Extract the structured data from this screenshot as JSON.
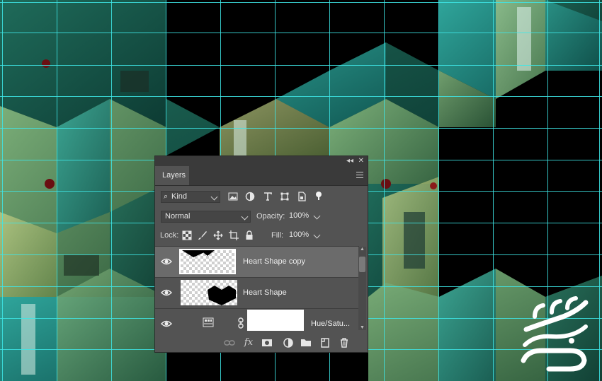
{
  "canvas": {
    "grid_color": "#3ee6e6",
    "background": "#000000"
  },
  "layers_panel": {
    "tab_label": "Layers",
    "collapse_glyph": "◂◂",
    "close_glyph": "✕",
    "filter": {
      "search_glyph": "⌕",
      "kind_label": "Kind",
      "type_icons": [
        "image-filter-icon",
        "adjustment-filter-icon",
        "type-filter-icon",
        "shape-filter-icon",
        "smart-object-filter-icon",
        "filter-toggle-icon"
      ]
    },
    "blend_mode": "Normal",
    "opacity_label": "Opacity:",
    "opacity_value": "100%",
    "lock_label": "Lock:",
    "fill_label": "Fill:",
    "fill_value": "100%",
    "layers": [
      {
        "name": "Heart Shape copy",
        "selected": true
      },
      {
        "name": "Heart Shape",
        "selected": false
      },
      {
        "name": "Hue/Satu...",
        "selected": false
      }
    ],
    "bottom_icons": [
      "link-icon",
      "fx-icon",
      "mask-icon",
      "adjustment-icon",
      "group-folder-icon",
      "new-layer-icon",
      "trash-icon"
    ],
    "fx_label": "fx"
  }
}
